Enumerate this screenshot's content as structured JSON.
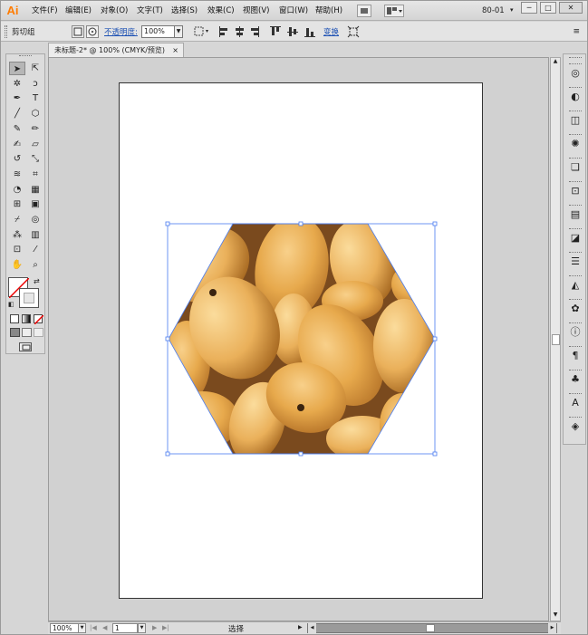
{
  "app": {
    "logo": "Ai",
    "workspace": "80-01",
    "window_controls": {
      "minimize": "─",
      "restore": "□",
      "close": "✕"
    }
  },
  "menu": [
    "文件(F)",
    "编辑(E)",
    "对象(O)",
    "文字(T)",
    "选择(S)",
    "效果(C)",
    "视图(V)",
    "窗口(W)",
    "帮助(H)"
  ],
  "control_bar": {
    "selection_label": "剪切组",
    "opacity_label": "不透明度:",
    "opacity_value": "100%",
    "transform_label": "变换"
  },
  "document": {
    "tab_title": "未标题-2* @ 100% (CMYK/预览)",
    "tab_close": "×"
  },
  "status_bar": {
    "zoom": "100%",
    "artboard_number": "1",
    "tool_label": "选择"
  },
  "toolbar": {
    "tools": [
      {
        "name": "selection-tool",
        "glyph": "➤"
      },
      {
        "name": "direct-selection-tool",
        "glyph": "⇱"
      },
      {
        "name": "magic-wand-tool",
        "glyph": "✲"
      },
      {
        "name": "lasso-tool",
        "glyph": "ↄ"
      },
      {
        "name": "pen-tool",
        "glyph": "✒"
      },
      {
        "name": "type-tool",
        "glyph": "T"
      },
      {
        "name": "line-tool",
        "glyph": "╱"
      },
      {
        "name": "polygon-tool",
        "glyph": "⬡"
      },
      {
        "name": "paintbrush-tool",
        "glyph": "✎"
      },
      {
        "name": "pencil-tool",
        "glyph": "✏"
      },
      {
        "name": "blob-brush-tool",
        "glyph": "✍"
      },
      {
        "name": "eraser-tool",
        "glyph": "▱"
      },
      {
        "name": "rotate-tool",
        "glyph": "↺"
      },
      {
        "name": "scale-tool",
        "glyph": "⤡"
      },
      {
        "name": "warp-tool",
        "glyph": "≋"
      },
      {
        "name": "free-transform-tool",
        "glyph": "⌗"
      },
      {
        "name": "shape-builder-tool",
        "glyph": "◔"
      },
      {
        "name": "perspective-grid-tool",
        "glyph": "▦"
      },
      {
        "name": "mesh-tool",
        "glyph": "⊞"
      },
      {
        "name": "gradient-tool",
        "glyph": "▣"
      },
      {
        "name": "eyedropper-tool",
        "glyph": "⌿"
      },
      {
        "name": "blend-tool",
        "glyph": "◎"
      },
      {
        "name": "symbol-sprayer-tool",
        "glyph": "⁂"
      },
      {
        "name": "column-graph-tool",
        "glyph": "▥"
      },
      {
        "name": "artboard-tool",
        "glyph": "⊡"
      },
      {
        "name": "slice-tool",
        "glyph": "⁄"
      },
      {
        "name": "hand-tool",
        "glyph": "✋"
      },
      {
        "name": "zoom-tool",
        "glyph": "⌕"
      }
    ]
  },
  "colors": {
    "selection_blue": "#4a7cf0",
    "artboard_border": "#333333",
    "canvas_bg": "#d1d1d1",
    "link_blue": "#1a4fb3",
    "logo_orange": "#ff7c00"
  }
}
